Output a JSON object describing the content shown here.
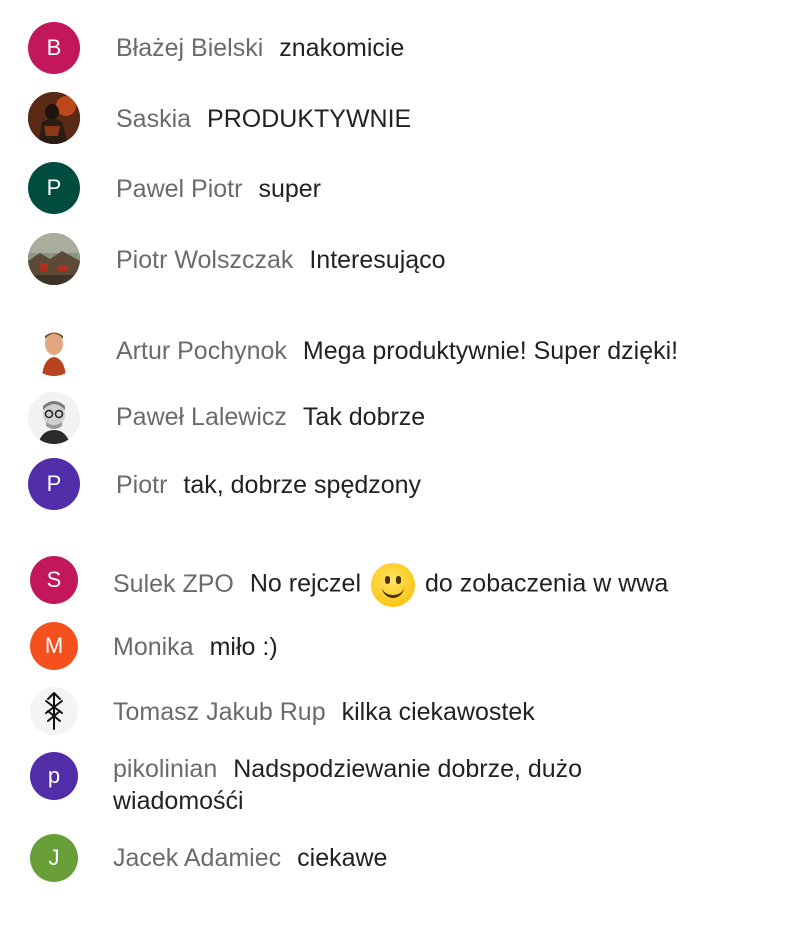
{
  "messages": [
    {
      "author": "Błażej Bielski",
      "text": "znakomicie",
      "avatar": {
        "type": "initial",
        "letter": "B",
        "color": "#c2185b"
      }
    },
    {
      "author": "Saskia",
      "text": "PRODUKTYWNIE",
      "avatar": {
        "type": "photo",
        "icon": "armored-figure-photo"
      }
    },
    {
      "author": "Pawel Piotr",
      "text": "super",
      "avatar": {
        "type": "initial",
        "letter": "P",
        "color": "#004d40"
      }
    },
    {
      "author": "Piotr Wolszczak",
      "text": "Interesująco",
      "avatar": {
        "type": "photo",
        "icon": "landscape-photo"
      }
    },
    {
      "author": "Artur Pochynok",
      "text": "Mega produktywnie! Super dzięki!",
      "avatar": {
        "type": "photo",
        "icon": "person-photo"
      }
    },
    {
      "author": "Paweł Lalewicz",
      "text": "Tak dobrze",
      "avatar": {
        "type": "photo",
        "icon": "person-glasses-photo"
      }
    },
    {
      "author": "Piotr",
      "text": "tak, dobrze spędzony",
      "avatar": {
        "type": "initial",
        "letter": "P",
        "color": "#512da8"
      }
    },
    {
      "author": "Sulek ZPO",
      "text_before": "No rejczel",
      "emoji": "slightly-smiling-face",
      "text_after": "do zobaczenia w wwa",
      "avatar": {
        "type": "initial",
        "letter": "S",
        "color": "#c2185b"
      }
    },
    {
      "author": "Monika",
      "text": "miło :)",
      "avatar": {
        "type": "initial",
        "letter": "M",
        "color": "#f4511e"
      }
    },
    {
      "author": "Tomasz Jakub Rup",
      "text": "kilka ciekawostek",
      "avatar": {
        "type": "logo",
        "icon": "rune-logo"
      }
    },
    {
      "author": "pikolinian",
      "text": "Nadspodziewanie dobrze, dużo wiadomośći",
      "avatar": {
        "type": "initial",
        "letter": "p",
        "color": "#512da8"
      }
    },
    {
      "author": "Jacek Adamiec",
      "text": "ciekawe",
      "avatar": {
        "type": "initial",
        "letter": "J",
        "color": "#689f38"
      }
    }
  ]
}
